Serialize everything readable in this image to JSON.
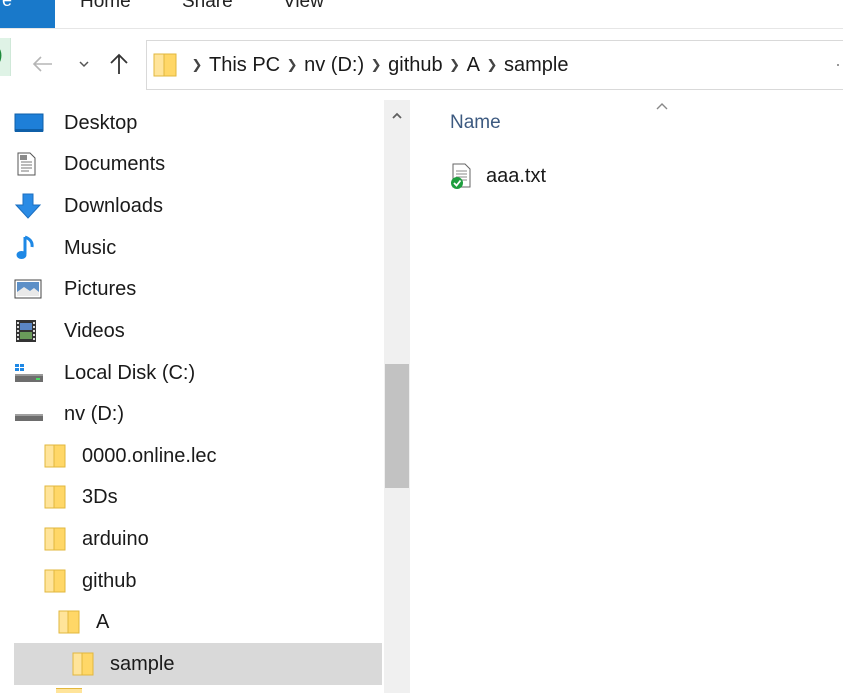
{
  "ribbon": {
    "tabs": [
      {
        "label": "Home"
      },
      {
        "label": "Share"
      },
      {
        "label": "View"
      }
    ],
    "file_tab_fragment": "e",
    "accent_color": "#1979ca"
  },
  "toolbar": {
    "back_icon": "arrow-left-icon",
    "recent_icon": "chevron-down-icon",
    "up_icon": "arrow-up-icon"
  },
  "address": {
    "breadcrumbs": [
      "This PC",
      "nv (D:)",
      "github",
      "A",
      "sample"
    ]
  },
  "sidebar": {
    "items": [
      {
        "label": "Desktop",
        "icon": "desktop-icon"
      },
      {
        "label": "Documents",
        "icon": "documents-icon"
      },
      {
        "label": "Downloads",
        "icon": "downloads-icon"
      },
      {
        "label": "Music",
        "icon": "music-icon"
      },
      {
        "label": "Pictures",
        "icon": "pictures-icon"
      },
      {
        "label": "Videos",
        "icon": "videos-icon"
      },
      {
        "label": "Local Disk (C:)",
        "icon": "system-drive-icon"
      },
      {
        "label": "nv (D:)",
        "icon": "drive-icon"
      },
      {
        "label": "0000.online.lec",
        "icon": "folder-icon"
      },
      {
        "label": "3Ds",
        "icon": "folder-icon"
      },
      {
        "label": "arduino",
        "icon": "folder-icon"
      },
      {
        "label": "github",
        "icon": "folder-icon"
      },
      {
        "label": "A",
        "icon": "folder-icon"
      },
      {
        "label": "sample",
        "icon": "folder-icon",
        "selected": true
      }
    ]
  },
  "content": {
    "column_name": "Name",
    "files": [
      {
        "name": "aaa.txt",
        "icon": "text-file-synced-icon"
      }
    ]
  }
}
